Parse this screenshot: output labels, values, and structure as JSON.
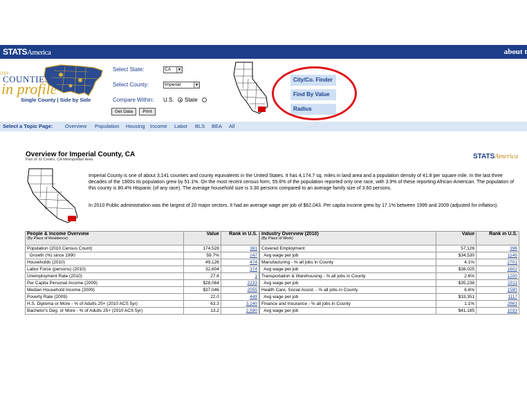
{
  "header": {
    "logo_main": "STATS",
    "logo_sub": "America",
    "about": "about t"
  },
  "brand": {
    "small": "USA",
    "line1": "COUNTIES",
    "line2": "in profile",
    "nav": "Single County | Side by Side"
  },
  "form": {
    "state_label": "Select State:",
    "state_value": "CA",
    "county_label": "Select County:",
    "county_value": "Imperial",
    "compare_label": "Compare Within:",
    "compare_us": "U.S.",
    "compare_state": "State",
    "get_data": "Get Data",
    "print": "Print"
  },
  "right_buttons": [
    "City/Co. Finder",
    "Find By Value",
    "Radius"
  ],
  "topics": {
    "label": "Select a Topic Page:",
    "items": [
      "Overview",
      "Population",
      "Housing",
      "Income",
      "Labor",
      "BLS",
      "BEA",
      "All"
    ]
  },
  "overview": {
    "title": "Overview for Imperial County, CA",
    "subtitle": "Part of: El Centro, CA Metropolitan Area",
    "p1": "Imperial County is one of about 3,141 counties and county equivalents in the United States. It has 4,174.7 sq. miles in land area and a population density of 41.8 per square mile. In the last three decades of the 1900s its population grew by 51.1%. On the most recent census form, 55.6% of the population reported only one race, with 3.9% of these reporting African-American. The population of this county is 80.4% Hispanic (of any race). The average household size is 3.30 persons compared to an average family size of 3.60 persons.",
    "p2": "In 2010 Public administration was the largest of 20 major sectors. It had an average wage per job of $62,043. Per capita income grew by 17.1% between 1999 and 2009 (adjusted for inflation).",
    "logo_a": "STATS",
    "logo_b": "America"
  },
  "people_table": {
    "title": "People & Income Overview",
    "subtitle": "(By Place of Residence)",
    "col_value": "Value",
    "col_rank": "Rank in U.S.",
    "rows": [
      {
        "label": "Population (2010 Census Count)",
        "value": "174,528",
        "rank": "381"
      },
      {
        "label": "  Growth (%) since 1990",
        "value": "59.7%",
        "rank": "247"
      },
      {
        "label": "Households (2010)",
        "value": "49,126",
        "rank": "474"
      },
      {
        "label": "Labor Force (persons) (2010)",
        "value": "32,604",
        "rank": "374"
      },
      {
        "label": "Unemployment Rate (2010)",
        "value": "27.6",
        "rank": "1"
      },
      {
        "label": "Per Capita Personal Income (2009)",
        "value": "$28,064",
        "rank": "2233"
      },
      {
        "label": "Median Household Income (2009)",
        "value": "$37,046",
        "rank": "2055"
      },
      {
        "label": "Poverty Rate (2009)",
        "value": "22.0",
        "rank": "449"
      },
      {
        "label": "H.S. Diploma or More - % of Adults 25+ (2010 ACS 5yr)",
        "value": "63.3",
        "rank": "3,140"
      },
      {
        "label": "Bachelor's Deg. or More - % of Adults 25+ (2010 ACS 5yr)",
        "value": "13.2",
        "rank": "2,590"
      }
    ]
  },
  "industry_table": {
    "title": "Industry Overview (2010)",
    "subtitle": "(By Place of Work)",
    "col_value": "Value",
    "col_rank": "Rank in U.S.",
    "rows": [
      {
        "label": "Covered Employment",
        "value": "57,126",
        "rank": "396"
      },
      {
        "label": "  Avg wage per job",
        "value": "$34,530",
        "rank": "1145"
      },
      {
        "label": "Manufacturing - % all jobs in County",
        "value": "4.1%",
        "rank": "2701"
      },
      {
        "label": "  Avg wage per job",
        "value": "$38,025",
        "rank": "1602"
      },
      {
        "label": "Transportation & Warehousing - % all jobs in County",
        "value": "2.6%",
        "rank": "1200"
      },
      {
        "label": "  Avg wage per job",
        "value": "$35,238",
        "rank": "2011"
      },
      {
        "label": "Health Care, Social Assist. - % all jobs in County",
        "value": "6.6%",
        "rank": "1590"
      },
      {
        "label": "  Avg wage per job",
        "value": "$33,351",
        "rank": "1117"
      },
      {
        "label": "Finance and Insurance - % all jobs in County",
        "value": "1.1%",
        "rank": "2863"
      },
      {
        "label": "  Avg wage per job",
        "value": "$41,185",
        "rank": "1033"
      }
    ]
  }
}
